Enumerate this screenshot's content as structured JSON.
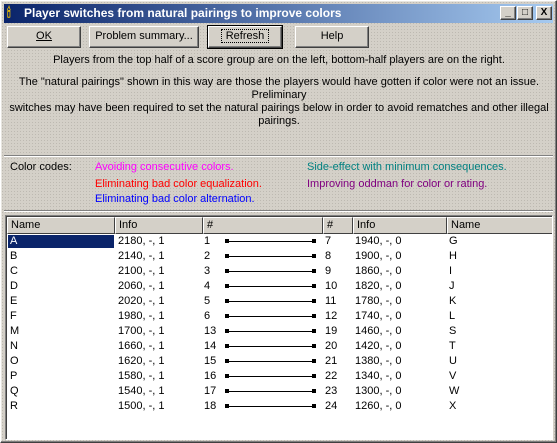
{
  "window": {
    "title": "Player switches from natural pairings to improve colors",
    "icon": "candle-icon",
    "minimize_glyph": "_",
    "maximize_glyph": "□",
    "close_glyph": "X"
  },
  "toolbar": {
    "ok_label": "OK",
    "problem_summary_label": "Problem summary...",
    "refresh_label": "Refresh",
    "help_label": "Help"
  },
  "intro": {
    "line1": "Players from the top half of a score group are on the left, bottom-half players are on the right.",
    "line2": "The \"natural pairings\" shown in this way are those the players would have gotten if color were not an issue.",
    "line3": "Preliminary",
    "line4": "switches may have been required to set the natural pairings below in order to avoid rematches and other illegal",
    "line5": "pairings."
  },
  "color_codes": {
    "label": "Color codes:",
    "items": [
      {
        "text": "Avoiding consecutive colors.",
        "color": "#ff00ff"
      },
      {
        "text": "Side-effect with minimum consequences.",
        "color": "#008080"
      },
      {
        "text": "Eliminating bad color equalization.",
        "color": "#ff0000"
      },
      {
        "text": "Improving oddman for color or rating.",
        "color": "#800080"
      },
      {
        "text": "Eliminating bad color alternation.",
        "color": "#0000ff"
      }
    ]
  },
  "table": {
    "headers": [
      "Name",
      "Info",
      "#",
      "#",
      "Info",
      "Name"
    ],
    "rows": [
      {
        "lname": "A",
        "linfo": "2180, -, 1",
        "lnum": "1",
        "rnum": "7",
        "rinfo": "1940, -, 0",
        "rname": "G",
        "selected": true
      },
      {
        "lname": "B",
        "linfo": "2140, -, 1",
        "lnum": "2",
        "rnum": "8",
        "rinfo": "1900, -, 0",
        "rname": "H"
      },
      {
        "lname": "C",
        "linfo": "2100, -, 1",
        "lnum": "3",
        "rnum": "9",
        "rinfo": "1860, -, 0",
        "rname": "I"
      },
      {
        "lname": "D",
        "linfo": "2060, -, 1",
        "lnum": "4",
        "rnum": "10",
        "rinfo": "1820, -, 0",
        "rname": "J"
      },
      {
        "lname": "E",
        "linfo": "2020, -, 1",
        "lnum": "5",
        "rnum": "11",
        "rinfo": "1780, -, 0",
        "rname": "K"
      },
      {
        "lname": "F",
        "linfo": "1980, -, 1",
        "lnum": "6",
        "rnum": "12",
        "rinfo": "1740, -, 0",
        "rname": "L"
      },
      {
        "lname": "M",
        "linfo": "1700, -, 1",
        "lnum": "13",
        "rnum": "19",
        "rinfo": "1460, -, 0",
        "rname": "S"
      },
      {
        "lname": "N",
        "linfo": "1660, -, 1",
        "lnum": "14",
        "rnum": "20",
        "rinfo": "1420, -, 0",
        "rname": "T"
      },
      {
        "lname": "O",
        "linfo": "1620, -, 1",
        "lnum": "15",
        "rnum": "21",
        "rinfo": "1380, -, 0",
        "rname": "U"
      },
      {
        "lname": "P",
        "linfo": "1580, -, 1",
        "lnum": "16",
        "rnum": "22",
        "rinfo": "1340, -, 0",
        "rname": "V"
      },
      {
        "lname": "Q",
        "linfo": "1540, -, 1",
        "lnum": "17",
        "rnum": "23",
        "rinfo": "1300, -, 0",
        "rname": "W"
      },
      {
        "lname": "R",
        "linfo": "1500, -, 1",
        "lnum": "18",
        "rnum": "24",
        "rinfo": "1260, -, 0",
        "rname": "X"
      }
    ]
  }
}
